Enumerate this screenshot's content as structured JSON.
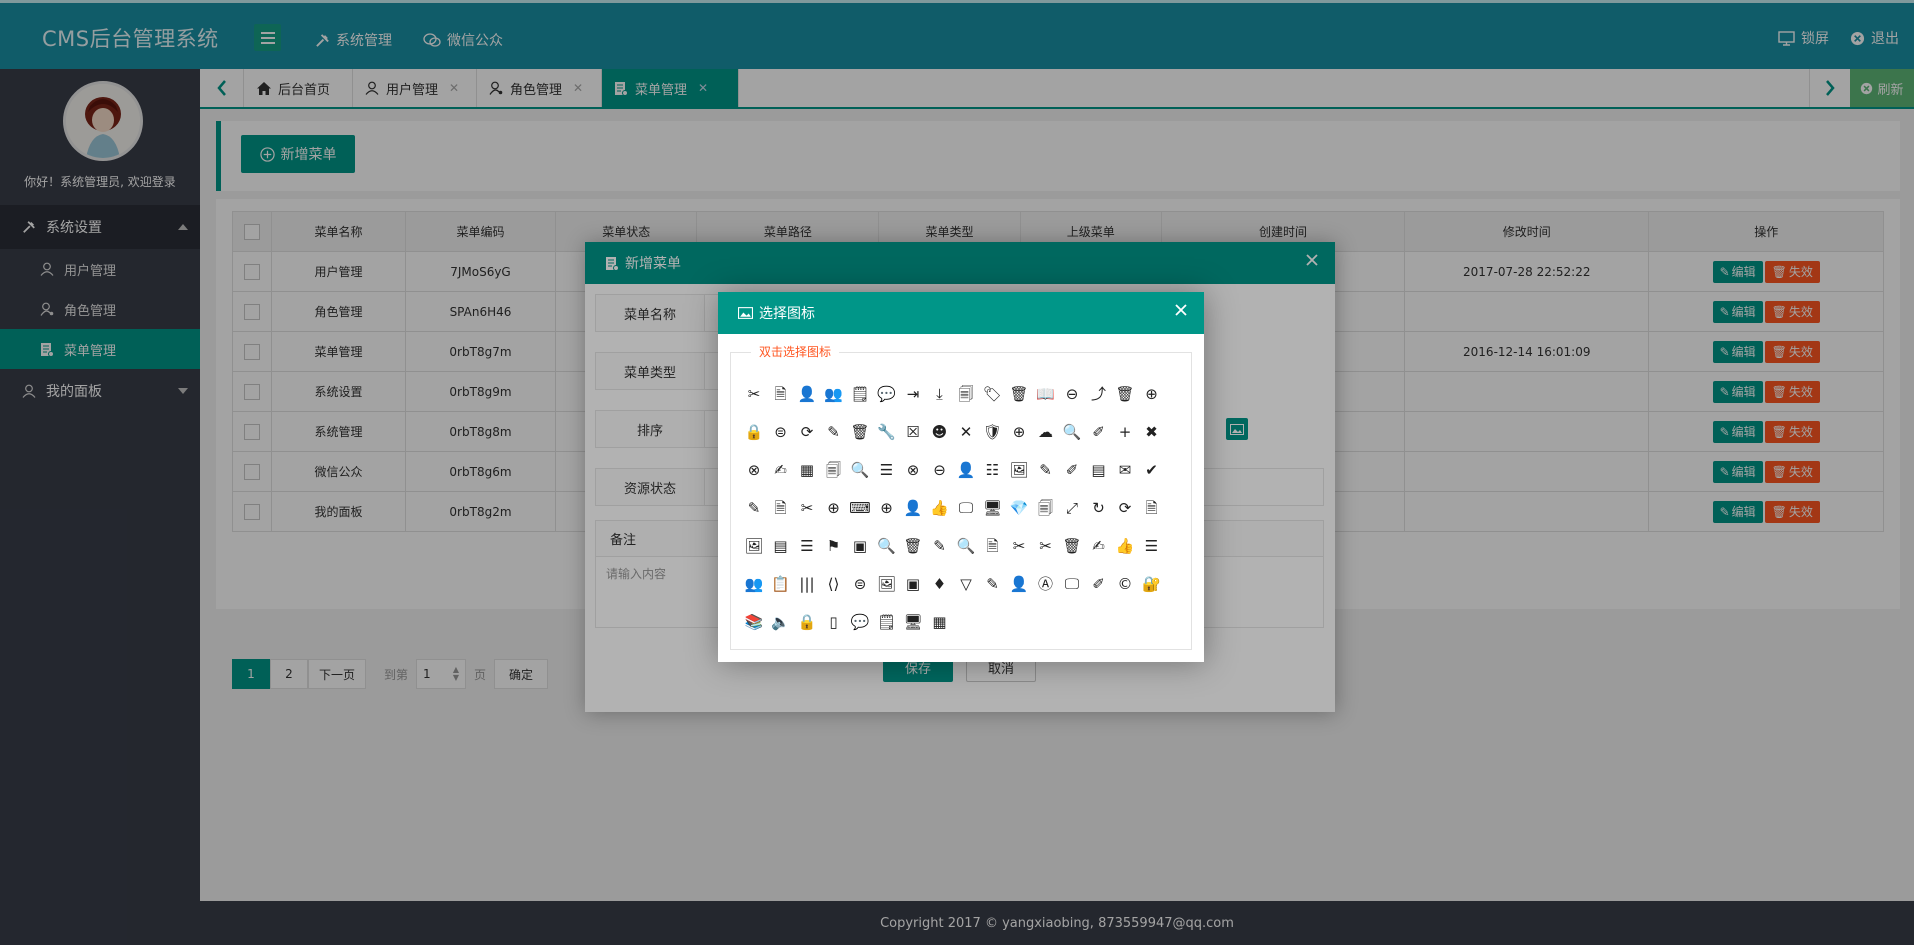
{
  "app": {
    "title": "CMS后台管理系统"
  },
  "topnav": [
    {
      "label": "系统管理",
      "icon": "tools-icon"
    },
    {
      "label": "微信公众",
      "icon": "wechat-icon"
    }
  ],
  "topright": {
    "lock": "锁屏",
    "logout": "退出"
  },
  "sidebar": {
    "welcome": "你好！系统管理员, 欢迎登录",
    "groups": [
      {
        "label": "系统设置",
        "items": [
          "用户管理",
          "角色管理",
          "菜单管理"
        ]
      },
      {
        "label": "我的面板"
      }
    ]
  },
  "tabs": [
    {
      "label": "后台首页"
    },
    {
      "label": "用户管理"
    },
    {
      "label": "角色管理"
    },
    {
      "label": "菜单管理"
    }
  ],
  "refresh": "刷新",
  "toolbar": {
    "add_label": "新增菜单"
  },
  "table": {
    "headers": [
      "菜单名称",
      "菜单编码",
      "菜单状态",
      "菜单路径",
      "菜单类型",
      "上级菜单",
      "创建时间",
      "修改时间",
      "操作"
    ],
    "rows": [
      {
        "name": "用户管理",
        "code": "7JMoS6yG",
        "mtime": "2017-07-28 22:52:22"
      },
      {
        "name": "角色管理",
        "code": "SPAn6H46",
        "mtime": ""
      },
      {
        "name": "菜单管理",
        "code": "0rbT8g7m",
        "mtime": "2016-12-14 16:01:09"
      },
      {
        "name": "系统设置",
        "code": "0rbT8g9m",
        "mtime": ""
      },
      {
        "name": "系统管理",
        "code": "0rbT8g8m",
        "mtime": ""
      },
      {
        "name": "微信公众",
        "code": "0rbT8g6m",
        "mtime": ""
      },
      {
        "name": "我的面板",
        "code": "0rbT8g2m",
        "mtime": ""
      }
    ],
    "edit": "编辑",
    "disable": "失效"
  },
  "pager": {
    "pages": [
      "1",
      "2"
    ],
    "next": "下一页",
    "goto": "到第",
    "page_value": "1",
    "page_unit": "页",
    "confirm": "确定"
  },
  "dialog_add": {
    "title": "新增菜单",
    "labels": {
      "name": "菜单名称",
      "type": "菜单类型",
      "sort": "排序",
      "status": "资源状态",
      "remark": "备注"
    },
    "remark_placeholder": "请输入内容",
    "save": "保存",
    "cancel": "取消"
  },
  "dialog_icon": {
    "title": "选择图标",
    "legend": "双击选择图标",
    "icons": [
      "✂",
      "🗎",
      "👤",
      "👥",
      "🗒",
      "💬",
      "⇥",
      "⤓",
      "🗐",
      "🏷",
      "🗑",
      "📖",
      "⊖",
      "⤴",
      "🗑",
      "⊕",
      "🔒",
      "⊜",
      "⟳",
      "✎",
      "🗑",
      "🔧",
      "☒",
      "☻",
      "✕",
      "🛡",
      "⊕",
      "☁",
      "🔍",
      "✐",
      "+",
      "✖",
      "⊗",
      "✍",
      "▦",
      "🗐",
      "🔍",
      "☰",
      "⊗",
      "⊖",
      "👤",
      "☷",
      "🖼",
      "✎",
      "✐",
      "▤",
      "✉",
      "✔",
      "✎",
      "🗎",
      "✂",
      "⊕",
      "⌨",
      "⊕",
      "👤",
      "👍",
      "🖵",
      "🖥",
      "💎",
      "🗐",
      "⤢",
      "↻",
      "⟳",
      "🗎",
      "🖼",
      "▤",
      "☰",
      "⚑",
      "▣",
      "🔍",
      "🗑",
      "✎",
      "🔍",
      "🗎",
      "✂",
      "✂",
      "🗑",
      "✍",
      "👍",
      "☰",
      "👥",
      "📋",
      "|||",
      "⟨⟩",
      "⊜",
      "🖼",
      "▣",
      "♦",
      "▽",
      "✎",
      "👤",
      "Ⓐ",
      "🖵",
      "✐",
      "©",
      "🔐",
      "📚",
      "🔈",
      "🔒",
      "▯",
      "💬",
      "🗒",
      "🖥",
      "▦"
    ]
  },
  "footer": {
    "copyright": "Copyright 2017 © yangxiaobing, 873559947@qq.com"
  },
  "colors": {
    "topbar": "#1a91a5",
    "accent": "#009688",
    "danger": "#ff5722",
    "sidebar": "#393d49"
  }
}
